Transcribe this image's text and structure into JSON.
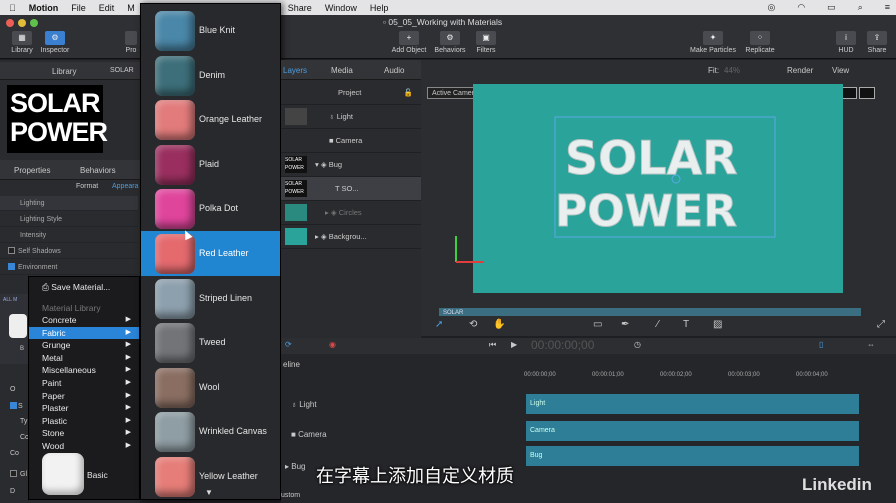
{
  "menubar": {
    "apple": "",
    "app": "Motion",
    "items": [
      "File",
      "Edit",
      "M",
      "Share",
      "Window",
      "Help"
    ]
  },
  "window": {
    "title": "05_05_Working with Materials"
  },
  "toolbar": {
    "library": "Library",
    "inspector": "Inspector",
    "pro": "Pro",
    "add_object": "Add Object",
    "behaviors": "Behaviors",
    "filters": "Filters",
    "make_particles": "Make Particles",
    "replicate": "Replicate",
    "hud": "HUD",
    "share": "Share"
  },
  "left_panel": {
    "tab_library": "Library",
    "tab_partial": "SOLAR",
    "thumb_title": "SOLAR\nPOWER",
    "tab_properties": "Properties",
    "tab_behaviors": "Behaviors",
    "format": "Format",
    "appearance": "Appeara",
    "rows": [
      "Lighting",
      "Lighting Style",
      "Intensity",
      "Self Shadows",
      "Environment"
    ],
    "side_letters": [
      "O",
      "S",
      "Ty",
      "Co",
      "Co",
      "Gl",
      "D"
    ],
    "all_label": "ALL M",
    "b_label": "B"
  },
  "context_menu": {
    "save_material": "Save Material...",
    "header": "Material Library",
    "items": [
      "Concrete",
      "Fabric",
      "Grunge",
      "Metal",
      "Miscellaneous",
      "Paint",
      "Paper",
      "Plaster",
      "Plastic",
      "Stone",
      "Wood"
    ],
    "selected": "Fabric",
    "basic": "Basic"
  },
  "materials": {
    "items": [
      {
        "label": "Blue Knit",
        "color": "#4a87a8"
      },
      {
        "label": "Denim",
        "color": "#3d6f7a"
      },
      {
        "label": "Orange Leather",
        "color": "#e27b7b"
      },
      {
        "label": "Plaid",
        "color": "#9a2f5f"
      },
      {
        "label": "Polka Dot",
        "color": "#e0459c"
      },
      {
        "label": "Red Leather",
        "color": "#e46a6e"
      },
      {
        "label": "Striped Linen",
        "color": "#8da0ad"
      },
      {
        "label": "Tweed",
        "color": "#727478"
      },
      {
        "label": "Wool",
        "color": "#8a6e62"
      },
      {
        "label": "Wrinkled Canvas",
        "color": "#8f9ea4"
      },
      {
        "label": "Yellow Leather",
        "color": "#e67d78"
      }
    ],
    "selected": "Red Leather"
  },
  "layers_panel": {
    "tab_layers": "Layers",
    "tab_media": "Media",
    "tab_audio": "Audio",
    "rows": [
      "Project",
      "Light",
      "Camera",
      "Bug",
      "SO...",
      "Circles",
      "Backgrou..."
    ]
  },
  "canvas": {
    "fit": "Fit:",
    "zoom": "44%",
    "render": "Render",
    "view": "View",
    "active_camera": "Active Camera",
    "title_line1": "SOLAR",
    "title_line2": "POWER",
    "mini_label": "SOLAR"
  },
  "timeline": {
    "timecode": "00:00:00;00",
    "label_ine": "eline",
    "rows": [
      "Light",
      "Camera",
      "Bug"
    ],
    "ticks": [
      "00:00:00;00",
      "00:00:01;00",
      "00:00:02;00",
      "00:00:03;00",
      "00:00:04;00"
    ],
    "tracks": [
      "Light",
      "Camera",
      "Bug"
    ],
    "custom": "ustom"
  },
  "overlay": {
    "subtitle": "在字幕上添加自定义材质",
    "watermark": "Linkedin"
  }
}
